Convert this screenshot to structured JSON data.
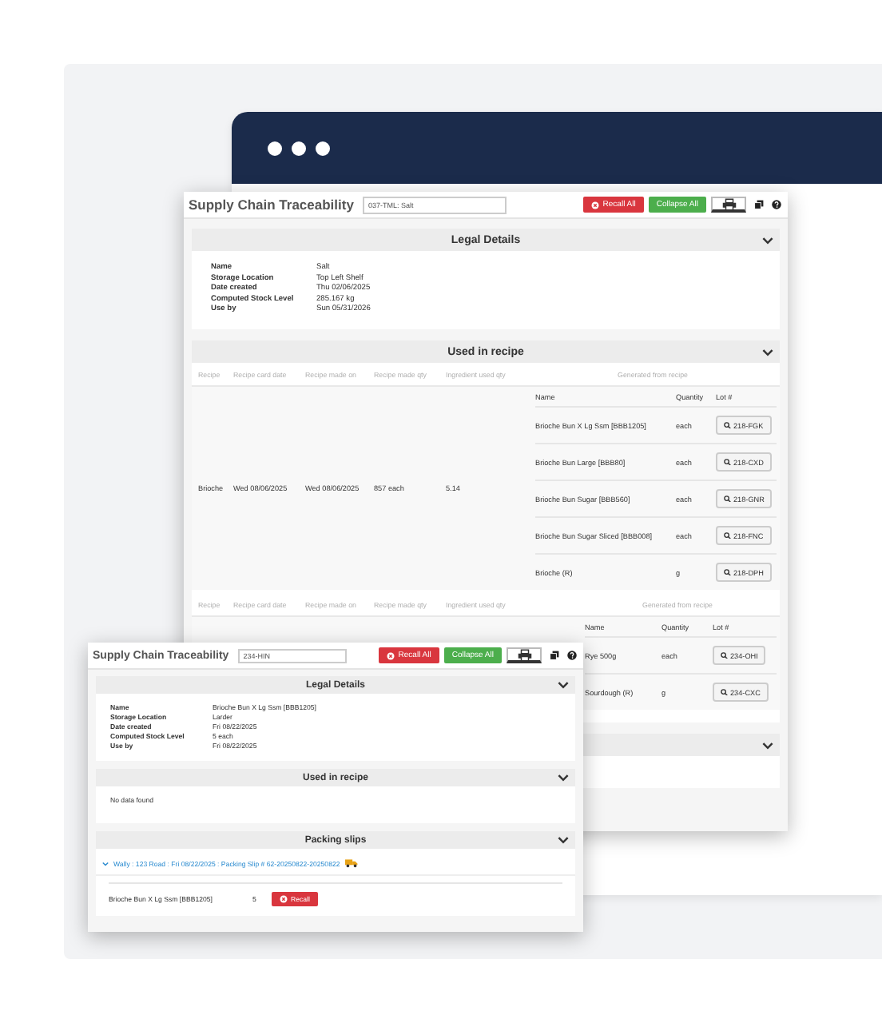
{
  "windows": [
    {
      "title": "Supply Chain Traceability",
      "search": "037-TML: Salt",
      "buttons": [
        {
          "kind": "recall",
          "label": "Recall All"
        },
        {
          "kind": "collapse",
          "label": "Collapse All"
        }
      ],
      "sections": [
        {
          "kind": "details",
          "title": "Legal Details",
          "expanded": true,
          "fields": [
            {
              "label": "Name",
              "value": "Salt"
            },
            {
              "label": "Storage Location",
              "value": "Top Left Shelf"
            },
            {
              "label": "Date created",
              "value": "Thu 02/06/2025"
            },
            {
              "label": "Computed Stock Level",
              "value": "285.167 kg"
            },
            {
              "label": "Use by",
              "value": "Sun 05/31/2026"
            }
          ]
        },
        {
          "kind": "recipes",
          "title": "Used in recipe",
          "expanded": true,
          "groups": [
            {
              "columns": [
                "Recipe",
                "Recipe card date",
                "Recipe made on",
                "Recipe made qty",
                "Ingredient used qty"
              ],
              "generated_heading": "Generated from recipe",
              "sub_columns": [
                "Name",
                "Quantity",
                "Lot #"
              ],
              "cells": [
                "Brioche",
                "Wed 08/06/2025",
                "Wed 08/06/2025",
                "857 each",
                "5.14"
              ],
              "items": [
                {
                  "name": "Brioche Bun X Lg Ssm [BBB1205]",
                  "quantity": "each",
                  "lot": "218-FGK"
                },
                {
                  "name": "Brioche Bun Large [BBB80]",
                  "quantity": "each",
                  "lot": "218-CXD"
                },
                {
                  "name": "Brioche Bun Sugar [BBB560]",
                  "quantity": "each",
                  "lot": "218-GNR"
                },
                {
                  "name": "Brioche Bun Sugar Sliced [BBB008]",
                  "quantity": "each",
                  "lot": "218-FNC"
                },
                {
                  "name": "Brioche (R)",
                  "quantity": "g",
                  "lot": "218-DPH"
                }
              ]
            },
            {
              "columns": [
                "Recipe",
                "Recipe card date",
                "Recipe made on",
                "Recipe made qty",
                "Ingredient used qty"
              ],
              "generated_heading": "Generated from recipe",
              "sub_columns": [
                "Name",
                "Quantity",
                "Lot #"
              ],
              "items": [
                {
                  "name": "Rye 500g",
                  "quantity": "each",
                  "lot": "234-OHI"
                },
                {
                  "name": "Sourdough (R)",
                  "quantity": "g",
                  "lot": "234-CXC"
                }
              ]
            }
          ]
        },
        {
          "kind": "covered",
          "expanded": true
        }
      ]
    },
    {
      "title": "Supply Chain Traceability",
      "search": "234-HIN",
      "buttons": [
        {
          "kind": "recall",
          "label": "Recall All"
        },
        {
          "kind": "collapse",
          "label": "Collapse All"
        }
      ],
      "sections": [
        {
          "kind": "details",
          "title": "Legal Details",
          "expanded": true,
          "fields": [
            {
              "label": "Name",
              "value": "Brioche Bun X Lg Ssm [BBB1205]"
            },
            {
              "label": "Storage Location",
              "value": "Larder"
            },
            {
              "label": "Date created",
              "value": "Fri 08/22/2025"
            },
            {
              "label": "Computed Stock Level",
              "value": "5 each"
            },
            {
              "label": "Use by",
              "value": "Fri 08/22/2025"
            }
          ]
        },
        {
          "kind": "empty",
          "title": "Used in recipe",
          "expanded": true,
          "message": "No data found"
        },
        {
          "kind": "packing",
          "title": "Packing slips",
          "expanded": true,
          "slips": [
            {
              "link": "Wally : 123 Road : Fri 08/22/2025 : Packing Slip # 62-20250822-20250822",
              "expanded": true,
              "items": [
                {
                  "name": "Brioche Bun X Lg Ssm [BBB1205]",
                  "quantity": "5",
                  "button": "Recall"
                }
              ]
            }
          ]
        }
      ]
    }
  ]
}
